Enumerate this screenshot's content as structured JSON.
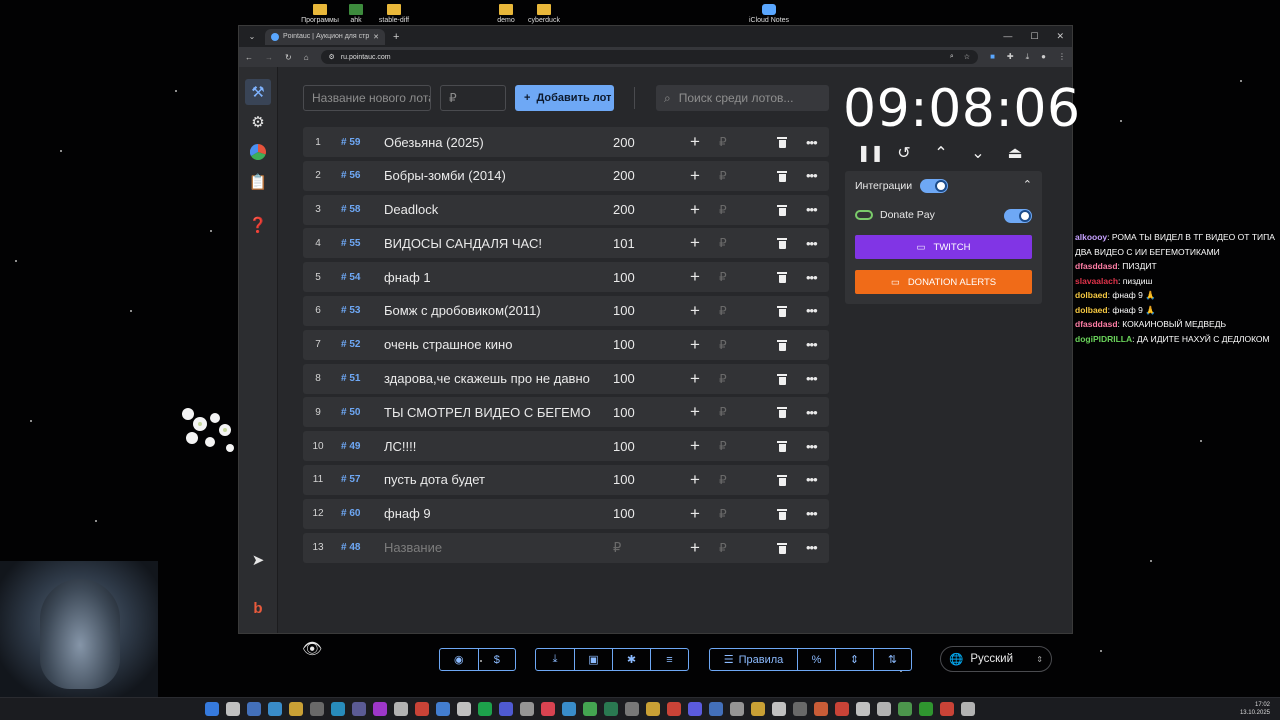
{
  "desktop": {
    "icons": [
      "Программы",
      "ahk",
      "stable-diff",
      "demo",
      "cyberduck",
      "iCloud Notes"
    ]
  },
  "chat": [
    {
      "user": "alkoooy",
      "color": "#c7a2ff",
      "text": "РОМА ТЫ ВИДЕЛ В ТГ ВИДЕО ОТ ТИПА ДВА ВИДЕО С ИИ БЕГЕМОТИКАМИ"
    },
    {
      "user": "dfasddasd",
      "color": "#ff7ea6",
      "text": "ПИЗДИТ"
    },
    {
      "user": "slavaalach",
      "color": "#e0334a",
      "text": "пиздиш"
    },
    {
      "user": "dolbaed",
      "color": "#f5c842",
      "text": "фнаф 9 🙏"
    },
    {
      "user": "dolbaed",
      "color": "#f5c842",
      "text": "фнаф 9 🙏"
    },
    {
      "user": "dfasddasd",
      "color": "#ff7ea6",
      "text": "КОКАИНОВЫЙ МЕДВЕДЬ"
    },
    {
      "user": "dogiPIDRILLA",
      "color": "#6ad35a",
      "text": "ДА ИДИТЕ НАХУЙ С ДЕДЛОКОМ"
    }
  ],
  "browser": {
    "tab_title": "Pointauc | Аукцион для стримов",
    "url": "ru.pointauc.com",
    "icons": {
      "back": "back-icon",
      "forward": "forward-icon",
      "reload": "reload-icon",
      "home": "home-icon"
    }
  },
  "app": {
    "new_lot_placeholder": "Название нового лота",
    "amount_placeholder": "₽",
    "add_button": "Добавить лот",
    "search_placeholder": "Поиск среди лотов...",
    "timer": "09:08:06",
    "lots": [
      {
        "idx": "1",
        "id": "# 59",
        "name": "Обезьяна (2025)",
        "amount": "200"
      },
      {
        "idx": "2",
        "id": "# 56",
        "name": "Бобры-зомби (2014)",
        "amount": "200"
      },
      {
        "idx": "3",
        "id": "# 58",
        "name": "Deadlock",
        "amount": "200"
      },
      {
        "idx": "4",
        "id": "# 55",
        "name": "ВИДОСЫ САНДАЛЯ ЧАС!",
        "amount": "101"
      },
      {
        "idx": "5",
        "id": "# 54",
        "name": "фнаф 1",
        "amount": "100"
      },
      {
        "idx": "6",
        "id": "# 53",
        "name": "Бомж с дробовиком(2011)",
        "amount": "100"
      },
      {
        "idx": "7",
        "id": "# 52",
        "name": "очень страшное кино",
        "amount": "100"
      },
      {
        "idx": "8",
        "id": "# 51",
        "name": "здарова,че скажешь про не давно",
        "amount": "100"
      },
      {
        "idx": "9",
        "id": "# 50",
        "name": "ТЫ СМОТРЕЛ ВИДЕО С БЕГЕМОТИКАМИ",
        "amount": "100"
      },
      {
        "idx": "10",
        "id": "# 49",
        "name": "ЛС!!!!",
        "amount": "100"
      },
      {
        "idx": "11",
        "id": "# 57",
        "name": "пусть дота будет",
        "amount": "100"
      },
      {
        "idx": "12",
        "id": "# 60",
        "name": "фнаф 9",
        "amount": "100"
      },
      {
        "idx": "13",
        "id": "# 48",
        "name": "Название",
        "amount": "₽",
        "placeholder": true
      }
    ],
    "rub_symbol": "₽",
    "integrations": {
      "title": "Интеграции",
      "donate_pay": "Donate Pay",
      "twitch": "TWITCH",
      "donation_alerts": "DONATION ALERTS"
    },
    "footer": {
      "rules": "Правила",
      "percent": "%",
      "language": "Русский"
    }
  },
  "taskbar": {
    "time": "17:02",
    "date": "13.10.2025"
  },
  "colors": {
    "accent": "#6ea8f5",
    "twitch": "#8135e5",
    "donation_alerts": "#f06b18"
  }
}
